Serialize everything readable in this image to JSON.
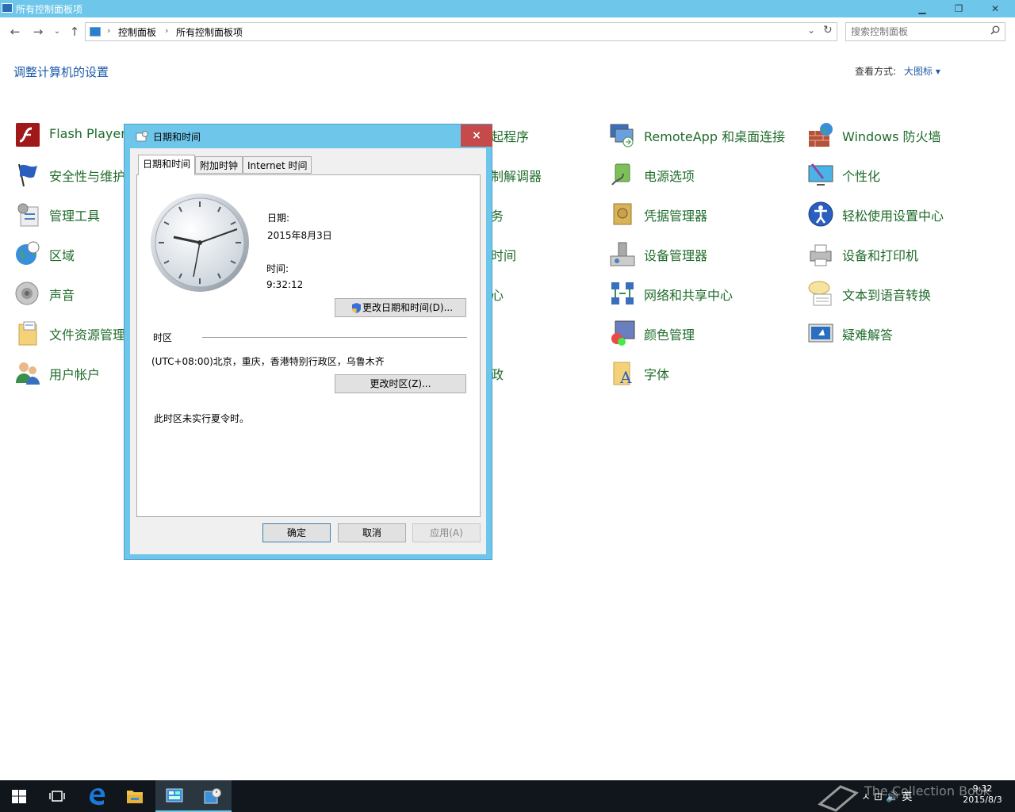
{
  "window": {
    "title": "所有控制面板项"
  },
  "address": {
    "crumb1": "控制面板",
    "crumb2": "所有控制面板项"
  },
  "search": {
    "placeholder": "搜索控制面板"
  },
  "header": {
    "title": "调整计算机的设置",
    "view_label": "查看方式:",
    "view_value": "大图标 ▾"
  },
  "items": [
    {
      "label": "Flash Player"
    },
    {
      "label": "安全性与维护"
    },
    {
      "label": "管理工具"
    },
    {
      "label": "区域"
    },
    {
      "label": "声音"
    },
    {
      "label": "文件资源管理器选项"
    },
    {
      "label": "用户帐户"
    },
    {
      "label": "起程序"
    },
    {
      "label": "制解调器"
    },
    {
      "label": "务"
    },
    {
      "label": "时间"
    },
    {
      "label": "心"
    },
    {
      "label": "政"
    },
    {
      "label": "RemoteApp 和桌面连接"
    },
    {
      "label": "电源选项"
    },
    {
      "label": "凭据管理器"
    },
    {
      "label": "设备管理器"
    },
    {
      "label": "网络和共享中心"
    },
    {
      "label": "颜色管理"
    },
    {
      "label": "字体"
    },
    {
      "label": "Windows 防火墙"
    },
    {
      "label": "个性化"
    },
    {
      "label": "轻松使用设置中心"
    },
    {
      "label": "设备和打印机"
    },
    {
      "label": "文本到语音转换"
    },
    {
      "label": "疑难解答"
    }
  ],
  "dialog": {
    "title": "日期和时间",
    "close": "×",
    "tabs": [
      "日期和时间",
      "附加时钟",
      "Internet 时间"
    ],
    "date_label": "日期:",
    "date_value": "2015年8月3日",
    "time_label": "时间:",
    "time_value": "9:32:12",
    "change_datetime": "更改日期和时间(D)...",
    "timezone_header": "时区",
    "timezone_value": "(UTC+08:00)北京，重庆，香港特别行政区，乌鲁木齐",
    "change_timezone": "更改时区(Z)...",
    "dst_note": "此时区未实行夏令时。",
    "ok": "确定",
    "cancel": "取消",
    "apply": "应用(A)"
  },
  "taskbar": {
    "tray_icons": "ㅅ  ⊡  🔊  英",
    "time": "9:32",
    "date": "2015/8/3",
    "watermark": "The Collection Book"
  }
}
